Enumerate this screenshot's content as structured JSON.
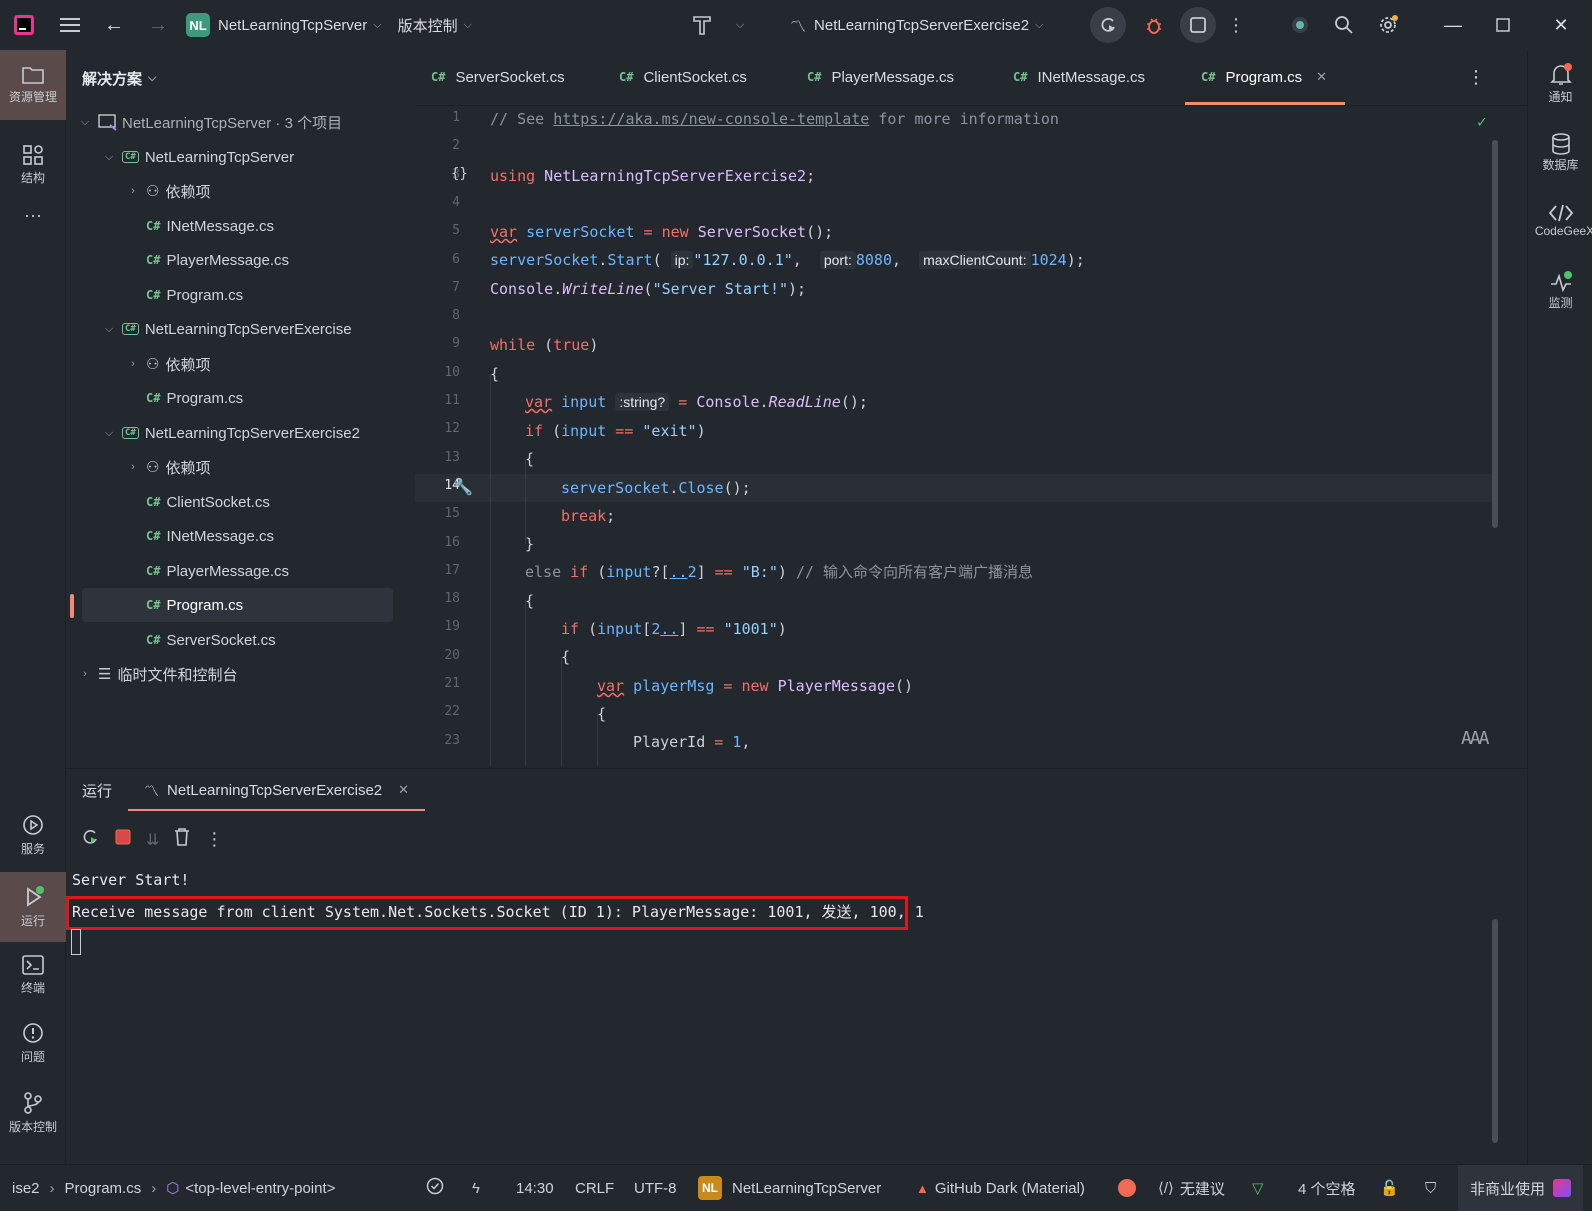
{
  "titlebar": {
    "project_badge": "NL",
    "project_name": "NetLearningTcpServer",
    "vcs_menu": "版本控制",
    "run_config": "NetLearningTcpServerExercise2"
  },
  "left_rail": {
    "explorer": "资源管理",
    "structure": "结构",
    "more": "···",
    "services": "服务",
    "run": "运行",
    "terminal": "终端",
    "problems": "问题",
    "vcs": "版本控制"
  },
  "right_rail": {
    "notifications": "通知",
    "database": "数据库",
    "codegeex": "CodeGeeX",
    "monitor": "监测"
  },
  "project_panel": {
    "header": "解决方案",
    "solution": "NetLearningTcpServer · 3 个项目",
    "p1": "NetLearningTcpServer",
    "deps": "依赖项",
    "p1_f1": "INetMessage.cs",
    "p1_f2": "PlayerMessage.cs",
    "p1_f3": "Program.cs",
    "p2": "NetLearningTcpServerExercise",
    "p2_f1": "Program.cs",
    "p3": "NetLearningTcpServerExercise2",
    "p3_f1": "ClientSocket.cs",
    "p3_f2": "INetMessage.cs",
    "p3_f3": "PlayerMessage.cs",
    "p3_f4": "Program.cs",
    "p3_f5": "ServerSocket.cs",
    "scratch": "临时文件和控制台"
  },
  "tabs": {
    "cs_badge": "C#",
    "t1": "ServerSocket.cs",
    "t2": "ClientSocket.cs",
    "t3": "PlayerMessage.cs",
    "t4": "INetMessage.cs",
    "t5": "Program.cs",
    "close": "✕"
  },
  "editor": {
    "line_numbers": [
      "1",
      "2",
      "3",
      "4",
      "5",
      "6",
      "7",
      "8",
      "9",
      "10",
      "11",
      "12",
      "13",
      "14",
      "15",
      "16",
      "17",
      "18",
      "19",
      "20",
      "21",
      "22",
      "23"
    ],
    "current_line": "14",
    "l1_a": "// See ",
    "l1_link": "https://aka.ms/new-console-template",
    "l1_b": " for more information",
    "l3_kw": "using",
    "l3_ns": " NetLearningTcpServerExercise2",
    "l3_semi": ";",
    "l5_var": "var",
    "l5_name": " serverSocket",
    "l5_eq": " = ",
    "l5_new": "new",
    "l5_type": " ServerSocket",
    "l5_end": "();",
    "l6_obj": "serverSocket",
    "l6_dot": ".",
    "l6_fn": "Start",
    "l6_p": "(",
    "l6_h1": "ip:",
    "l6_s1": "\"127.0.0.1\"",
    "l6_c1": ", ",
    "l6_h2": "port:",
    "l6_n1": "8080",
    "l6_c2": ", ",
    "l6_h3": "maxClientCount:",
    "l6_n2": "1024",
    "l6_end": ");",
    "l7_obj": "Console",
    "l7_dot": ".",
    "l7_fn": "WriteLine",
    "l7_p": "(",
    "l7_s": "\"Server Start!\"",
    "l7_end": ");",
    "l9_kw": "while",
    "l9_p1": " (",
    "l9_v": "true",
    "l9_p2": ")",
    "brace_open": "{",
    "brace_close": "}",
    "l11_var": "var",
    "l11_name": " input",
    "l11_hint": ":string?",
    "l11_eq": " = ",
    "l11_obj": "Console",
    "l11_dot": ".",
    "l11_fn": "ReadLine",
    "l11_end": "();",
    "l12_kw": "if",
    "l12_p": " (",
    "l12_v": "input",
    "l12_op": " == ",
    "l12_s": "\"exit\"",
    "l12_end": ")",
    "l14_obj": "serverSocket",
    "l14_dot": ".",
    "l14_fn": "Close",
    "l14_end": "();",
    "l15_kw": "break",
    "l15_end": ";",
    "l17_else": "else ",
    "l17_if": "if",
    "l17_p": " (",
    "l17_v": "input",
    "l17_q": "?[",
    "l17_r": "..",
    "l17_n": "2",
    "l17_rb": "]",
    "l17_op": " == ",
    "l17_s": "\"B:\"",
    "l17_end": ") ",
    "l17_cm": "// 输入命令向所有客户端广播消息",
    "l19_kw": "if",
    "l19_p": " (",
    "l19_v": "input",
    "l19_lb": "[",
    "l19_n": "2",
    "l19_r": "..",
    "l19_rb": "]",
    "l19_op": " == ",
    "l19_s": "\"1001\"",
    "l19_end": ")",
    "l21_var": "var",
    "l21_name": " playerMsg",
    "l21_eq": " = ",
    "l21_new": "new",
    "l21_type": " PlayerMessage",
    "l21_end": "()",
    "l23_prop": "PlayerId",
    "l23_eq": " = ",
    "l23_n": "1",
    "l23_end": ",",
    "braces_icon": "{}",
    "reader_mode": "AAA"
  },
  "run_panel": {
    "title": "运行",
    "tab": "NetLearningTcpServerExercise2",
    "close": "✕",
    "out1": "Server Start!",
    "out2": "Receive message from client System.Net.Sockets.Socket (ID 1): PlayerMessage: 1001, 发送, 100, 1"
  },
  "status_bar": {
    "crumb1": "ise2",
    "crumb2": "Program.cs",
    "crumb3": "<top-level-entry-point>",
    "position": "14:30",
    "line_sep": "CRLF",
    "encoding": "UTF-8",
    "proj_badge": "NL",
    "project": "NetLearningTcpServer",
    "theme": "GitHub Dark (Material)",
    "suggest": "无建议",
    "indent": "4 个空格",
    "license": "非商业使用"
  },
  "colors": {
    "accent": "#f08b74",
    "highlight_box": "#e0161d",
    "cs_green": "#76c38f"
  }
}
